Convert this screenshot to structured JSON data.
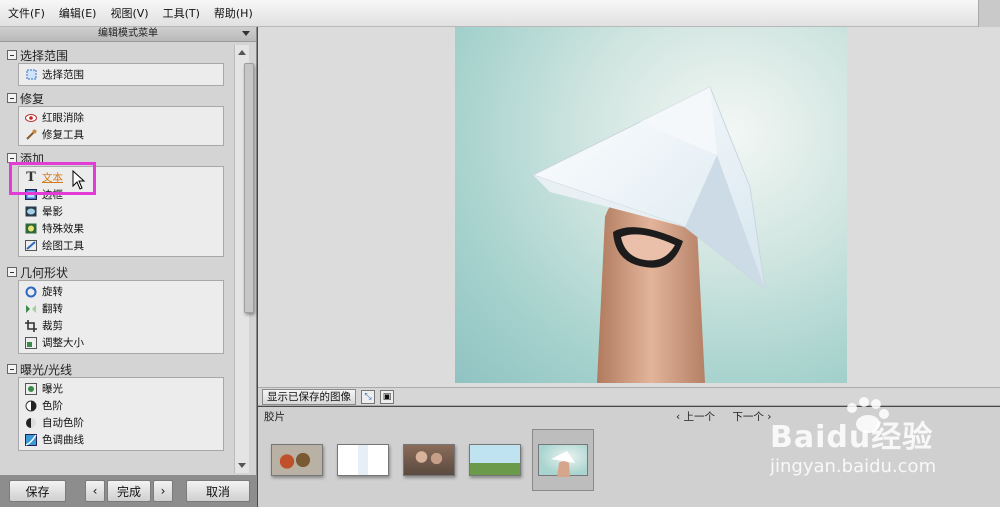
{
  "menubar": {
    "items": [
      "文件(F)",
      "编辑(E)",
      "视图(V)",
      "工具(T)",
      "帮助(H)"
    ]
  },
  "panel": {
    "title": "编辑模式菜单",
    "sections": [
      {
        "title": "选择范围",
        "items": [
          {
            "label": "选择范围",
            "icon": "selection-icon"
          }
        ]
      },
      {
        "title": "修复",
        "items": [
          {
            "label": "红眼消除",
            "icon": "eye-icon"
          },
          {
            "label": "修复工具",
            "icon": "brush-icon"
          }
        ]
      },
      {
        "title": "添加",
        "items": [
          {
            "label": "文本",
            "icon": "text-icon"
          },
          {
            "label": "边框",
            "icon": "frame-icon"
          },
          {
            "label": "晕影",
            "icon": "vignette-icon"
          },
          {
            "label": "特殊效果",
            "icon": "effects-icon"
          },
          {
            "label": "绘图工具",
            "icon": "pen-icon"
          }
        ]
      },
      {
        "title": "几何形状",
        "items": [
          {
            "label": "旋转",
            "icon": "rotate-icon"
          },
          {
            "label": "翻转",
            "icon": "flip-icon"
          },
          {
            "label": "裁剪",
            "icon": "crop-icon"
          },
          {
            "label": "调整大小",
            "icon": "resize-icon"
          }
        ]
      },
      {
        "title": "曝光/光线",
        "items": [
          {
            "label": "曝光",
            "icon": "exposure-icon"
          },
          {
            "label": "色阶",
            "icon": "levels-icon"
          },
          {
            "label": "自动色阶",
            "icon": "auto-levels-icon"
          },
          {
            "label": "色调曲线",
            "icon": "curves-icon"
          }
        ]
      }
    ]
  },
  "buttons": {
    "save": "保存",
    "done": "完成",
    "cancel": "取消",
    "prev": "‹",
    "next": "›"
  },
  "filmstrip": {
    "show_saved": "显示已保存的图像",
    "title": "胶片",
    "prev": "‹ 上一个",
    "next": "下一个 ›"
  },
  "watermark": {
    "brand": "Baidu经验",
    "url": "jingyan.baidu.com"
  },
  "colors": {
    "highlight": "#e23bd6",
    "active_text": "#d47a1a"
  }
}
